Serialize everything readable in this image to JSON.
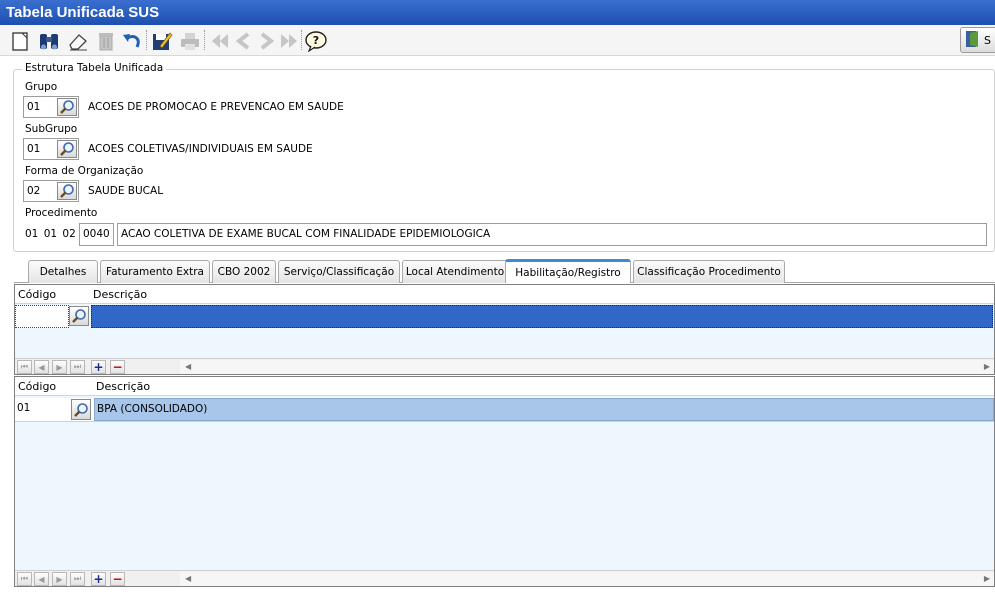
{
  "window": {
    "title": "Tabela Unificada SUS"
  },
  "toolbar": {
    "icons": [
      "new-icon",
      "search-binoculars-icon",
      "eraser-icon",
      "trash-icon",
      "undo-icon",
      "edit-icon",
      "print-icon",
      "first-icon",
      "previous-icon",
      "next-icon",
      "last-icon",
      "help-icon",
      "exit-icon"
    ],
    "exit_label": "S"
  },
  "structure": {
    "legend": "Estrutura Tabela Unificada",
    "grupo": {
      "label": "Grupo",
      "code": "01",
      "description": "ACOES DE PROMOCAO E PREVENCAO EM SAUDE"
    },
    "subgrupo": {
      "label": "SubGrupo",
      "code": "01",
      "description": "ACOES COLETIVAS/INDIVIDUAIS EM SAUDE"
    },
    "forma": {
      "label": "Forma de Organização",
      "code": "02",
      "description": "SAUDE BUCAL"
    },
    "procedimento": {
      "label": "Procedimento",
      "parts": "01 01 02",
      "code": "0040",
      "description": "ACAO COLETIVA DE EXAME BUCAL COM FINALIDADE EPIDEMIOLOGICA"
    }
  },
  "tabs": [
    {
      "label": "Detalhes",
      "active": false
    },
    {
      "label": "Faturamento Extra",
      "active": false
    },
    {
      "label": "CBO 2002",
      "active": false
    },
    {
      "label": "Serviço/Classificação",
      "active": false
    },
    {
      "label": "Local Atendimento",
      "active": false
    },
    {
      "label": "Habilitação/Registro",
      "active": true
    },
    {
      "label": "Classificação Procedimento",
      "active": false
    }
  ],
  "grid_top": {
    "columns": [
      "Código",
      "Descrição"
    ],
    "rows": [
      {
        "code": "",
        "description": ""
      }
    ],
    "colors": {
      "selected": "#3168c8"
    }
  },
  "grid_bottom": {
    "columns": [
      "Código",
      "Descrição"
    ],
    "rows": [
      {
        "code": "01",
        "description": "BPA (CONSOLIDADO)"
      }
    ],
    "colors": {
      "selected": "#a7c6ea"
    }
  }
}
